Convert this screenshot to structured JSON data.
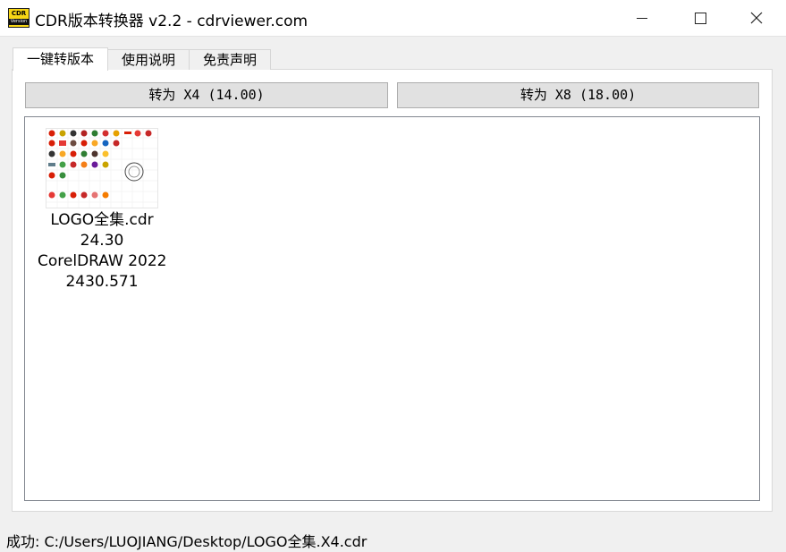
{
  "window": {
    "title": "CDR版本转换器 v2.2 - cdrviewer.com",
    "icon_text_top": "CDR",
    "icon_text_bottom": "Version",
    "controls": [
      "minimize-icon",
      "maximize-icon",
      "close-icon"
    ]
  },
  "tabs": [
    {
      "label": "一键转版本",
      "active": true
    },
    {
      "label": "使用说明",
      "active": false
    },
    {
      "label": "免责声明",
      "active": false
    }
  ],
  "buttons": {
    "convert_x4": "转为 X4 (14.00)",
    "convert_x8": "转为 X8 (18.00)"
  },
  "files": [
    {
      "name": "LOGO全集.cdr",
      "version": "24.30",
      "app": "CorelDRAW 2022",
      "build": "2430.571"
    }
  ],
  "status": "成功: C:/Users/LUOJIANG/Desktop/LOGO全集.X4.cdr",
  "colors": {
    "window_bg": "#f0f0f0",
    "panel_bg": "#ffffff",
    "button_bg": "#e1e1e1",
    "icon_yellow": "#f7d615"
  }
}
